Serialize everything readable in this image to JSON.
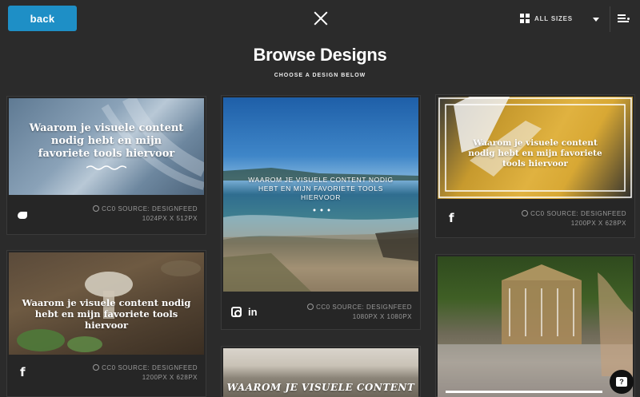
{
  "header": {
    "back_label": "back",
    "sizes_label": "ALL SIZES"
  },
  "page": {
    "title": "Browse Designs",
    "subtitle": "CHOOSE A DESIGN BELOW"
  },
  "cards": [
    {
      "overlay": "Waarom je visuele content nodig hebt en mijn favoriete tools hiervoor",
      "social": "twitter-icon",
      "source": "CC0 SOURCE: DESIGNFEED",
      "size": "1024PX X 512PX"
    },
    {
      "overlay": "WAAROM JE VISUELE CONTENT NODIG HEBT EN MIJN FAVORIETE TOOLS HIERVOOR",
      "social": "instagram-linkedin",
      "source": "CC0 SOURCE: DESIGNFEED",
      "size": "1080PX X 1080PX"
    },
    {
      "overlay": "Waarom je visuele content nodig hebt en mijn favoriete tools hiervoor",
      "social": "facebook-icon",
      "source": "CC0 SOURCE: DESIGNFEED",
      "size": "1200PX X 628PX"
    },
    {
      "overlay": "Waarom je visuele content nodig hebt en mijn favoriete tools hiervoor",
      "social": "facebook-icon",
      "source": "CC0 SOURCE: DESIGNFEED",
      "size": "1200PX X 628PX"
    },
    {
      "overlay": "WAAROM JE VISUELE CONTENT"
    },
    {
      "overlay": ""
    }
  ],
  "icons": {
    "facebook": "f",
    "linkedin": "in",
    "help": "?"
  },
  "colors": {
    "accent": "#1e8fc6",
    "background": "#2b2b2b"
  }
}
